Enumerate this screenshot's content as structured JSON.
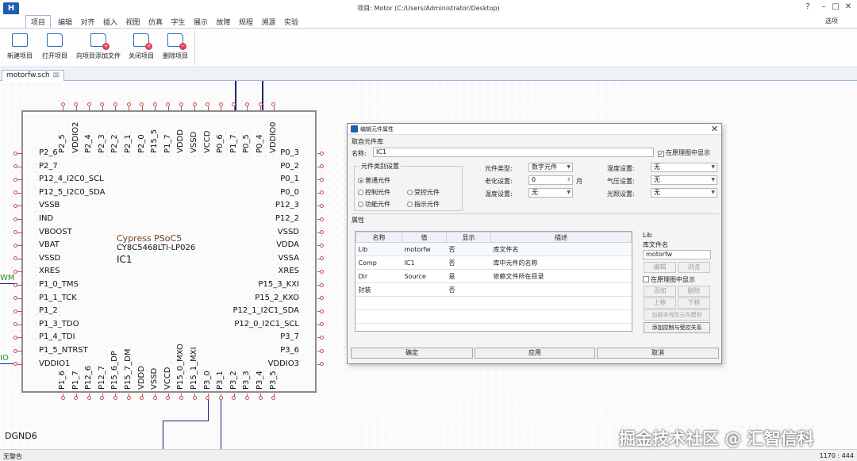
{
  "app": {
    "logo": "H",
    "title": "项目: Motor (C:/Users/Administrator/Desktop)",
    "options": "选项"
  },
  "menu": [
    "项目",
    "编辑",
    "对齐",
    "插入",
    "视图",
    "仿真",
    "字生",
    "展示",
    "故障",
    "规程",
    "溯源",
    "实验"
  ],
  "ribbon": [
    {
      "label": "新建项目",
      "icon": "new-project-icon"
    },
    {
      "label": "打开项目",
      "icon": "open-folder-icon"
    },
    {
      "label": "向项目添加文件",
      "icon": "add-file-icon"
    },
    {
      "label": "关闭项目",
      "icon": "close-project-icon"
    },
    {
      "label": "删除项目",
      "icon": "delete-project-icon"
    }
  ],
  "doc_tab": {
    "label": "motorfw.sch",
    "close": "⌧"
  },
  "component": {
    "name": "Cypress PSoC5",
    "part": "CY8C5468LTI-LP026",
    "ref": "IC1"
  },
  "pins": {
    "top": [
      "P2_5",
      "VDDIO2",
      "P2_4",
      "P2_3",
      "P2_2",
      "P2_1",
      "P2_0",
      "P15_5",
      "P1_7",
      "VDDD",
      "VSSD",
      "VCCD",
      "P0_6",
      "P1_7",
      "P0_5",
      "P0_4",
      "VDDIO0"
    ],
    "left": [
      "P2_6",
      "P2_7",
      "P12_4_I2C0_SCL",
      "P12_5_I2C0_SDA",
      "VSSB",
      "IND",
      "VBOOST",
      "VBAT",
      "VSSD",
      "XRES",
      "P1_0_TMS",
      "P1_1_TCK",
      "P1_2",
      "P1_3_TDO",
      "P1_4_TDI",
      "P1_5_NTRST",
      "VDDIO1"
    ],
    "right": [
      "P0_3",
      "P0_2",
      "P0_1",
      "P0_0",
      "P12_3",
      "P12_2",
      "VSSD",
      "VDDA",
      "VSSA",
      "XRES",
      "P15_3_KXI",
      "P15_2_KXO",
      "P12_1_I2C1_SDA",
      "P12_0_I2C1_SCL",
      "P3_7",
      "P3_6",
      "VDDIO3"
    ],
    "bottom": [
      "P1_6",
      "P1_7",
      "P12_6",
      "P12_7",
      "P15_6_DP",
      "P15_7_DM",
      "VDDD",
      "VSSD",
      "VCCD",
      "P15_0_MXO",
      "P15_1_MXI",
      "P3_0",
      "P3_1",
      "P3_2",
      "P3_3",
      "P3_4",
      "P3_5"
    ]
  },
  "net_labels": {
    "left1": "WM",
    "left2": "IO",
    "ground": "DGND6"
  },
  "watermark": "掘金技术社区 @ 汇智信科",
  "status": {
    "left": "无警告",
    "right": "1170 : 444"
  },
  "dialog": {
    "title": "编辑元件属性",
    "from_lib": "取自元件库",
    "name_label": "名称:",
    "name_value": "IC1",
    "show_in_sch": "在原理图中显示",
    "group_label": "元件类别设置",
    "radios": [
      "普通元件",
      "控制元件",
      "受控元件",
      "功能元件",
      "指示元件"
    ],
    "type_label": "元件类型:",
    "type_value": "数字元件",
    "age_label": "老化设置:",
    "age_value": "0",
    "age_unit": "月",
    "temp_label": "温度设置:",
    "temp_value": "无",
    "humid_label": "湿度设置:",
    "humid_value": "无",
    "pressure_label": "气压设置:",
    "pressure_value": "无",
    "light_label": "光照设置:",
    "light_value": "无",
    "props_label": "属性",
    "columns": [
      "名称",
      "值",
      "显示",
      "描述"
    ],
    "rows": [
      [
        "Lib",
        "motorfw",
        "否",
        "库文件名"
      ],
      [
        "Comp",
        "IC1",
        "否",
        "库中元件的名称"
      ],
      [
        "Dir",
        "Source",
        "是",
        "依赖文件所在目录"
      ],
      [
        "封装",
        "",
        "否",
        ""
      ]
    ],
    "side_title": "Lib",
    "side_sub": "库文件名",
    "side_value": "motorfw",
    "btn_edit": "编辑",
    "btn_browse": "浏览",
    "side_show": "在原理图中显示",
    "btn_add": "添加",
    "btn_delete": "删除",
    "btn_up": "上移",
    "btn_down": "下移",
    "btn_nonlinear": "加载非线性元件模型",
    "btn_ctrl": "添加控制与受控关系",
    "ok": "确定",
    "apply": "应用",
    "cancel": "取消"
  }
}
